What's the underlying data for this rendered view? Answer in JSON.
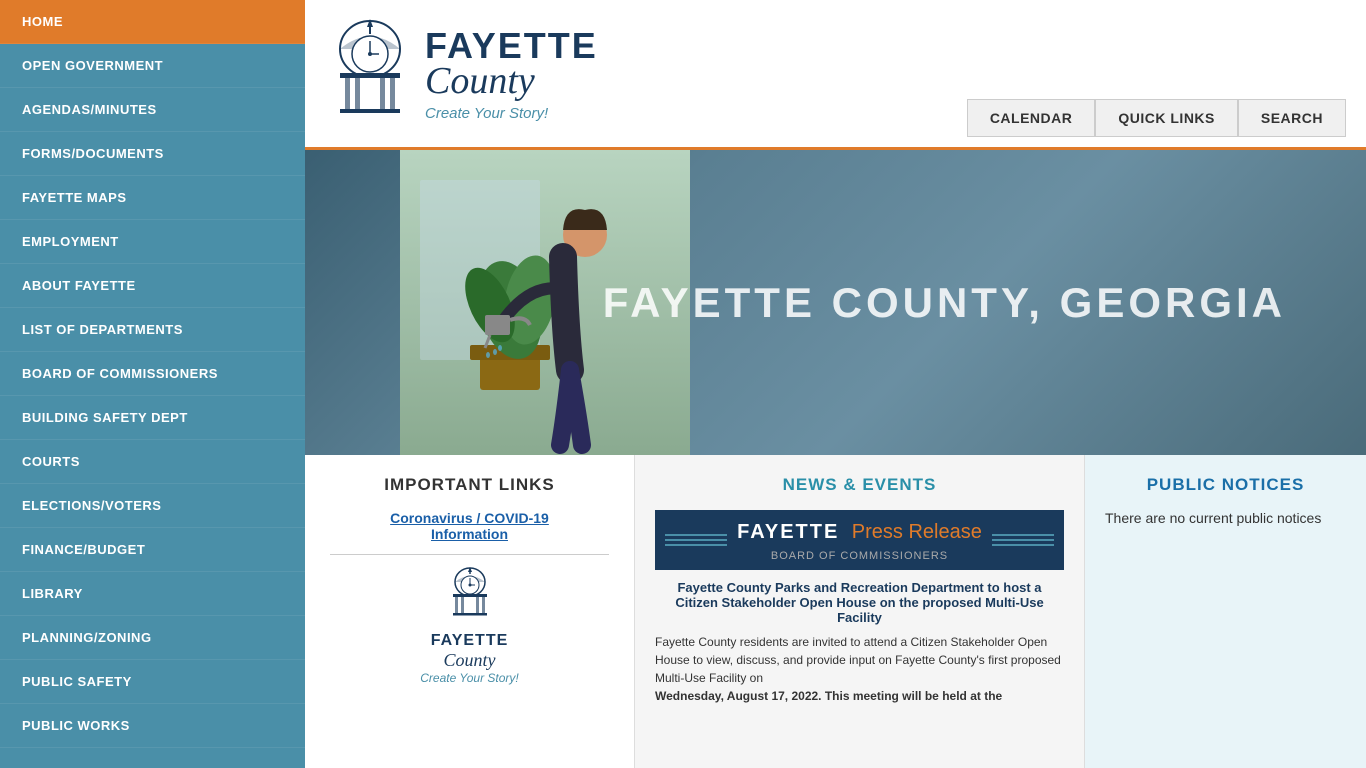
{
  "sidebar": {
    "items": [
      {
        "id": "home",
        "label": "HOME",
        "active": true
      },
      {
        "id": "open-government",
        "label": "OPEN GOVERNMENT",
        "active": false
      },
      {
        "id": "agendas-minutes",
        "label": "AGENDAS/MINUTES",
        "active": false
      },
      {
        "id": "forms-documents",
        "label": "FORMS/DOCUMENTS",
        "active": false
      },
      {
        "id": "fayette-maps",
        "label": "FAYETTE MAPS",
        "active": false
      },
      {
        "id": "employment",
        "label": "EMPLOYMENT",
        "active": false
      },
      {
        "id": "about-fayette",
        "label": "ABOUT FAYETTE",
        "active": false
      },
      {
        "id": "list-of-departments",
        "label": "LIST OF DEPARTMENTS",
        "active": false
      },
      {
        "id": "board-of-commissioners",
        "label": "BOARD OF COMMISSIONERS",
        "active": false
      },
      {
        "id": "building-safety-dept",
        "label": "BUILDING SAFETY DEPT",
        "active": false
      },
      {
        "id": "courts",
        "label": "COURTS",
        "active": false
      },
      {
        "id": "elections-voters",
        "label": "ELECTIONS/VOTERS",
        "active": false
      },
      {
        "id": "finance-budget",
        "label": "FINANCE/BUDGET",
        "active": false
      },
      {
        "id": "library",
        "label": "LIBRARY",
        "active": false
      },
      {
        "id": "planning-zoning",
        "label": "PLANNING/ZONING",
        "active": false
      },
      {
        "id": "public-safety",
        "label": "PUBLIC SAFETY",
        "active": false
      },
      {
        "id": "public-works",
        "label": "PUBLIC WORKS",
        "active": false
      }
    ]
  },
  "header": {
    "logo_fayette": "FAYETTE",
    "logo_county": "County",
    "logo_tagline": "Create Your Story!",
    "buttons": [
      {
        "id": "calendar",
        "label": "CALENDAR"
      },
      {
        "id": "quick-links",
        "label": "QUICK LINKS"
      },
      {
        "id": "search",
        "label": "SEARCH"
      }
    ]
  },
  "hero": {
    "title": "FAYETTE COUNTY, GEORGIA"
  },
  "important_links": {
    "title": "IMPORTANT LINKS",
    "link1_line1": "Coronavirus / COVID-19",
    "link1_line2": "Information",
    "logo_fayette": "FAYETTE",
    "logo_county": "County",
    "logo_tagline": "Create Your Story!"
  },
  "news_events": {
    "title": "NEWS & EVENTS",
    "press_fayette": "FAYETTE",
    "press_release": "Press Release",
    "press_sub": "BOARD OF COMMISSIONERS",
    "article_title": "Fayette County Parks and Recreation Department to host a Citizen Stakeholder Open House on the proposed Multi-Use Facility",
    "article_body": "Fayette County residents are invited to attend a Citizen Stakeholder Open House to view, discuss, and provide input on Fayette County's first proposed Multi-Use Facility on",
    "article_body_bold": "Wednesday, August 17, 2022. This meeting will be held at the"
  },
  "public_notices": {
    "title": "PUBLIC NOTICES",
    "body": "There are no current public notices"
  }
}
